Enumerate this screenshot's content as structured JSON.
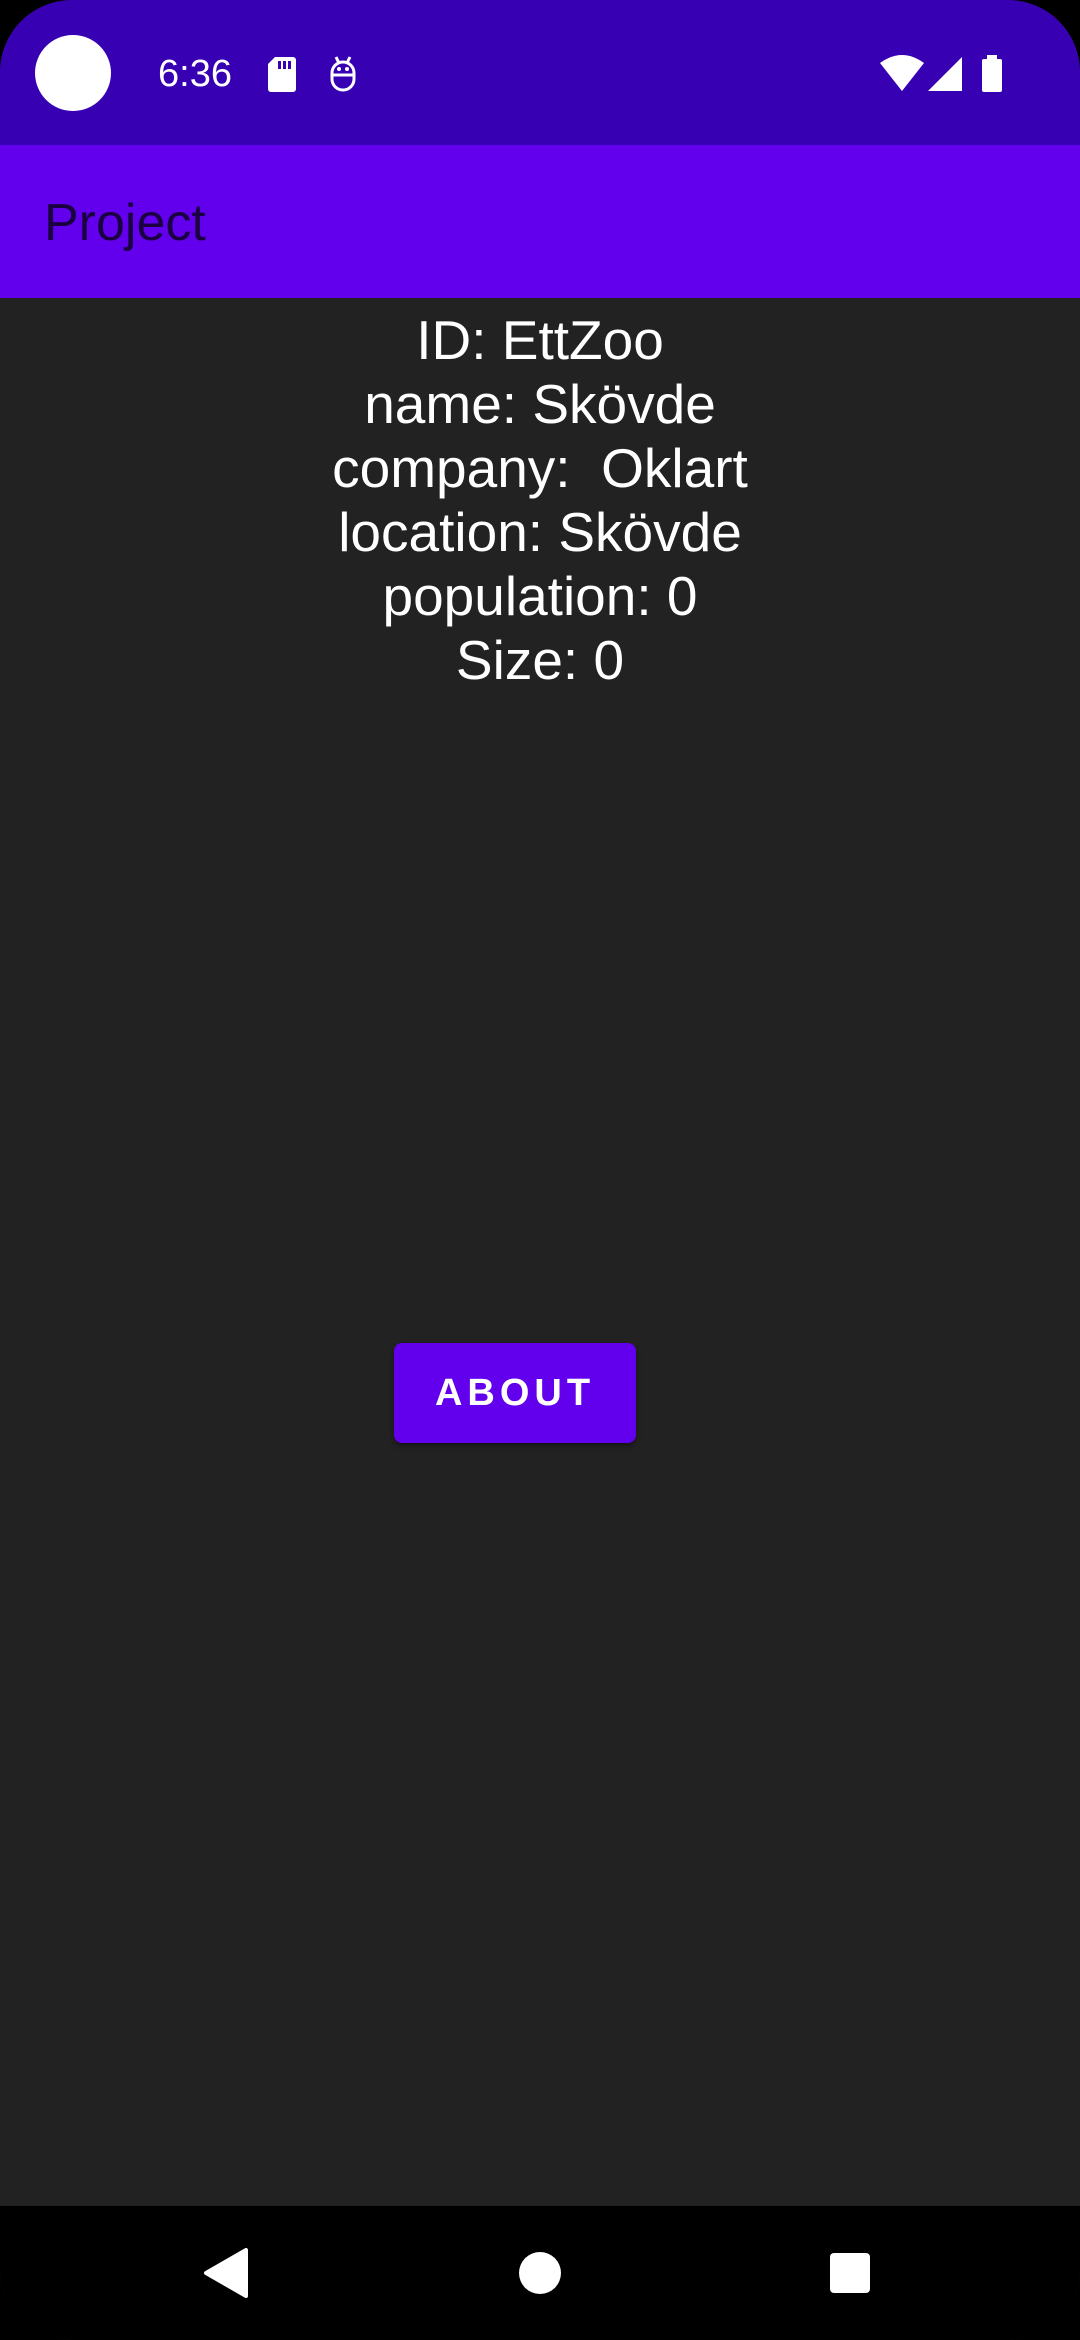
{
  "status_bar": {
    "time": "6:36",
    "icons": [
      "camera-cutout",
      "sd-card-icon",
      "android-debug-icon",
      "wifi-icon",
      "cellular-signal-icon",
      "battery-icon"
    ]
  },
  "app_bar": {
    "title": "Project"
  },
  "details": {
    "id_line": "ID: EttZoo",
    "name_line": "name: Skövde",
    "company_line": "company:  Oklart",
    "location_line": "location: Skövde",
    "population_line": "population: 0",
    "size_line": "Size: 0"
  },
  "about_button": {
    "label": "ABOUT"
  },
  "nav_bar": {
    "icons": [
      "back-icon",
      "home-icon",
      "recents-icon"
    ]
  },
  "colors": {
    "status_bar": "#3700B3",
    "app_bar": "#6200EE",
    "background": "#222222",
    "button": "#6200EE"
  }
}
